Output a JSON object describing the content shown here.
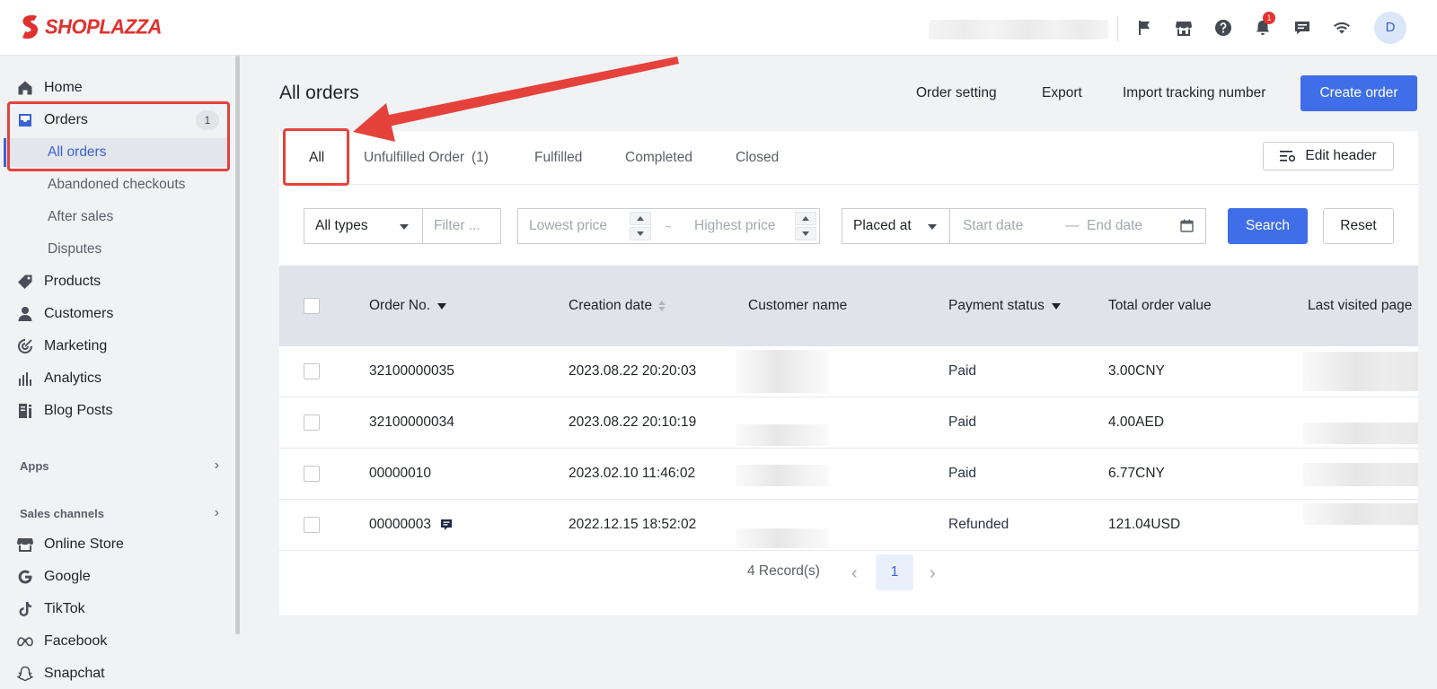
{
  "brand": {
    "name": "SHOPLAZZA",
    "color": "#e0312e"
  },
  "topbar": {
    "icons": [
      "flag-icon",
      "store-icon",
      "help-icon",
      "bell-icon",
      "chat-icon",
      "wifi-icon"
    ],
    "notification_count": "1",
    "avatar_letter": "D"
  },
  "sidebar": {
    "home": "Home",
    "orders": "Orders",
    "orders_count": "1",
    "orders_sub": [
      "All orders",
      "Abandoned checkouts",
      "After sales",
      "Disputes"
    ],
    "products": "Products",
    "customers": "Customers",
    "marketing": "Marketing",
    "analytics": "Analytics",
    "blog_posts": "Blog Posts",
    "apps_label": "Apps",
    "sales_channels_label": "Sales channels",
    "channels": [
      "Online Store",
      "Google",
      "TikTok",
      "Facebook",
      "Snapchat"
    ]
  },
  "page": {
    "title": "All orders",
    "order_setting": "Order setting",
    "export": "Export",
    "import_tracking": "Import tracking number",
    "create_order": "Create order"
  },
  "tabs": {
    "all": "All",
    "unfulfilled": "Unfulfilled Order",
    "unfulfilled_count": "(1)",
    "fulfilled": "Fulfilled",
    "completed": "Completed",
    "closed": "Closed",
    "edit_header": "Edit header"
  },
  "filters": {
    "type_value": "All types",
    "filter_placeholder": "Filter ...",
    "lowest_price_placeholder": "Lowest price",
    "range_sep": "~",
    "highest_price_placeholder": "Highest price",
    "date_field_value": "Placed at",
    "start_date_placeholder": "Start date",
    "date_sep": "—",
    "end_date_placeholder": "End date",
    "search": "Search",
    "reset": "Reset"
  },
  "table": {
    "columns": [
      "Order No.",
      "Creation date",
      "Customer name",
      "Payment status",
      "Total order value",
      "Last visited page"
    ],
    "rows": [
      {
        "order_no": "32100000035",
        "date": "2023.08.22 20:20:03",
        "payment": "Paid",
        "total": "3.00CNY",
        "note": false
      },
      {
        "order_no": "32100000034",
        "date": "2023.08.22 20:10:19",
        "payment": "Paid",
        "total": "4.00AED",
        "note": false
      },
      {
        "order_no": "00000010",
        "date": "2023.02.10 11:46:02",
        "payment": "Paid",
        "total": "6.77CNY",
        "note": false
      },
      {
        "order_no": "00000003",
        "date": "2022.12.15 18:52:02",
        "payment": "Refunded",
        "total": "121.04USD",
        "note": true
      }
    ]
  },
  "pagination": {
    "records": "4 Record(s)",
    "current_page": "1"
  },
  "colors": {
    "accent": "#3f6ee8",
    "annotation_red": "#e5423c"
  }
}
